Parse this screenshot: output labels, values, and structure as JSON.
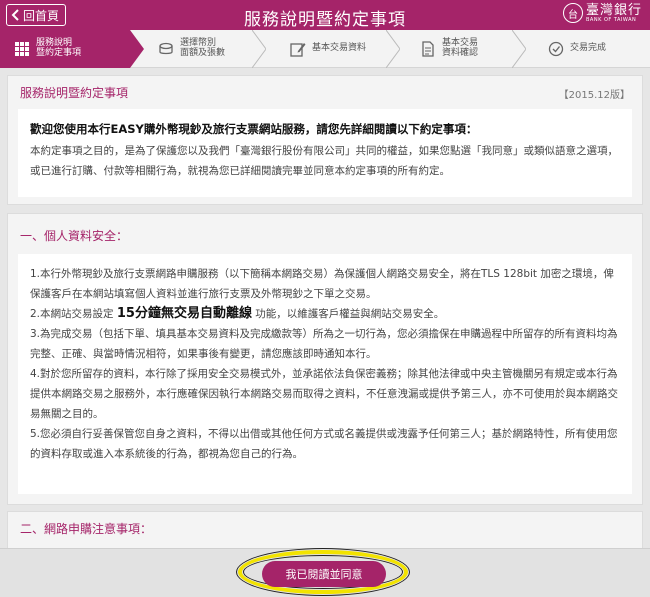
{
  "header": {
    "back_label": "回首頁",
    "title": "服務說明暨約定事項",
    "brand_cn": "臺灣銀行",
    "brand_en": "BANK OF TAIWAN",
    "brand_logo_char": "台"
  },
  "steps": [
    {
      "label": "服務說明\n暨約定事項",
      "icon": "grid-icon",
      "active": true
    },
    {
      "label": "選擇幣別\n面額及張數",
      "icon": "coins-icon",
      "active": false
    },
    {
      "label": "基本交易資料",
      "icon": "edit-icon",
      "active": false
    },
    {
      "label": "基本交易\n資料確認",
      "icon": "document-icon",
      "active": false
    },
    {
      "label": "交易完成",
      "icon": "check-circle-icon",
      "active": false
    }
  ],
  "intro": {
    "heading": "服務說明暨約定事項",
    "version": "【2015.12版】",
    "lead": "歡迎您使用本行EASY購外幣現鈔及旅行支票網站服務，請您先詳細閱讀以下約定事項：",
    "body": "本約定事項之目的，是為了保護您以及我們「臺灣銀行股份有限公司」共同的權益，如果您點選「我同意」或類似語意之選項，或已進行訂購、付款等相關行為，就視為您已詳細閱讀完畢並同意本約定事項的所有約定。"
  },
  "section1": {
    "heading": "一、個人資料安全：",
    "items": [
      "1.本行外幣現鈔及旅行支票網路申購服務（以下簡稱本網路交易）為保護個人網路交易安全，將在TLS 128bit 加密之環境，俾保護客戶在本網站填寫個人資料並進行旅行支票及外幣現鈔之下單之交易。",
      "3.為完成交易（包括下單、填具基本交易資料及完成繳款等）所為之一切行為，您必須擔保在申購過程中所留存的所有資料均為完整、正確、與當時情況相符，如果事後有變更，請您應該即時通知本行。",
      "4.對於您所留存的資料，本行除了採用安全交易模式外，並承諾依法負保密義務；除其他法律或中央主管機關另有規定或本行為提供本網路交易之服務外，本行應確保因執行本網路交易而取得之資料，不任意洩漏或提供予第三人，亦不可使用於與本網路交易無關之目的。",
      "5.您必須自行妥善保管您自身之資料，不得以出借或其他任何方式或名義提供或洩露予任何第三人；基於網路特性，所有使用您的資料存取或進入本系統後的行為，都視為您自己的行為。"
    ],
    "item2_pre": "2.本網站交易設定 ",
    "item2_highlight": "15分鐘無交易自動離線",
    "item2_post": " 功能，以維護客戶權益與網站交易安全。"
  },
  "section2": {
    "heading": "二、網路申購注意事項："
  },
  "footer": {
    "agree_label": "我已閱讀並同意"
  }
}
